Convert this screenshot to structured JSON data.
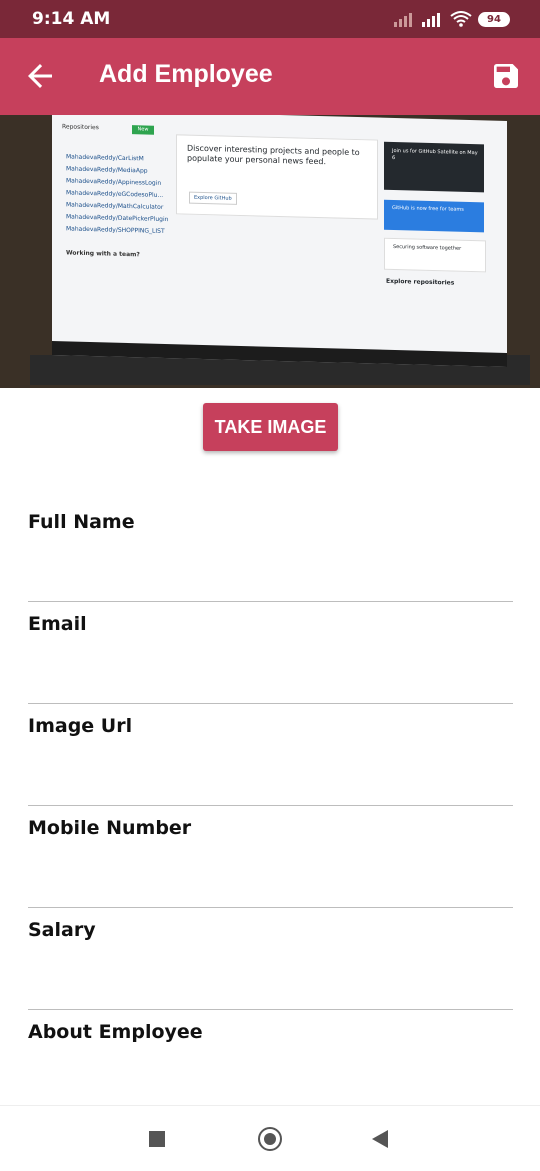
{
  "status_bar": {
    "time": "9:14 AM",
    "battery": "94"
  },
  "app_bar": {
    "title": "Add Employee",
    "back_icon": "arrow-left-icon",
    "save_icon": "floppy-disk-icon"
  },
  "header_image": {
    "description_icon": "employee-photo"
  },
  "take_image_button": {
    "label": "TAKE IMAGE"
  },
  "form": {
    "fields": [
      {
        "label": "Full Name",
        "value": ""
      },
      {
        "label": "Email",
        "value": ""
      },
      {
        "label": "Image Url",
        "value": ""
      },
      {
        "label": "Mobile Number",
        "value": ""
      },
      {
        "label": "Salary",
        "value": ""
      },
      {
        "label": "About Employee",
        "value": ""
      }
    ]
  },
  "colors": {
    "primary": "#c6405c",
    "status_bar": "#7a2838"
  },
  "screenshot_text": {
    "repositories": "Repositories",
    "new": "New",
    "discover": "Discover interesting projects and people to populate your personal news feed.",
    "explore": "Explore GitHub",
    "working_team": "Working with a team?",
    "repos": [
      "MahadevaReddy/CarListM",
      "MahadevaReddy/MediaApp",
      "MahadevaReddy/AppinessLogin",
      "MahadevaReddy/eGCodesoPlu...",
      "MahadevaReddy/MathCalculator",
      "MahadevaReddy/DatePickerPlugin",
      "MahadevaReddy/SHOPPING_LIST"
    ],
    "join_us": "Join us for GitHub Satellite on May 6",
    "free_teams": "GitHub is now free for teams",
    "securing": "Securing software together",
    "explore_repos": "Explore repositories"
  }
}
